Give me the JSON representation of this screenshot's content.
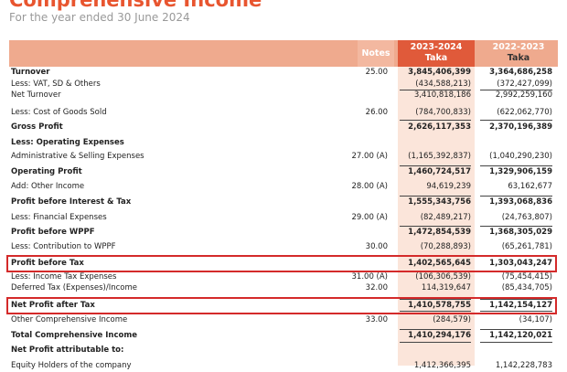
{
  "title": "Comprehensive Income",
  "subtitle": "For the year ended 30 June 2024",
  "header": {
    "notes": "Notes",
    "col1_year": "2023-2024",
    "col1_unit": "Taka",
    "col2_year": "2022-2023",
    "col2_unit": "Taka"
  },
  "rows": [
    {
      "label": "Turnover",
      "note": "25.00",
      "v1": "3,845,406,399",
      "v2": "3,364,686,258",
      "bold": true
    },
    {
      "label": "Less: VAT, SD & Others",
      "note": "",
      "v1": "(434,588,213)",
      "v2": "(372,427,099)",
      "bold": false
    },
    {
      "label": "Net Turnover",
      "note": "",
      "v1": "3,410,818,186",
      "v2": "2,992,259,160",
      "bold": false
    },
    {
      "label": "Less: Cost of Goods Sold",
      "note": "26.00",
      "v1": "(784,700,833)",
      "v2": "(622,062,770)",
      "bold": false
    },
    {
      "label": "Gross Profit",
      "note": "",
      "v1": "2,626,117,353",
      "v2": "2,370,196,389",
      "bold": true
    },
    {
      "label": "Less: Operating Expenses",
      "note": "",
      "v1": "",
      "v2": "",
      "bold": true
    },
    {
      "label": "Administrative & Selling Expenses",
      "note": "27.00 (A)",
      "v1": "(1,165,392,837)",
      "v2": "(1,040,290,230)",
      "bold": false
    },
    {
      "label": "Operating Profit",
      "note": "",
      "v1": "1,460,724,517",
      "v2": "1,329,906,159",
      "bold": true
    },
    {
      "label": "Add: Other Income",
      "note": "28.00 (A)",
      "v1": "94,619,239",
      "v2": "63,162,677",
      "bold": false
    },
    {
      "label": "Profit before Interest & Tax",
      "note": "",
      "v1": "1,555,343,756",
      "v2": "1,393,068,836",
      "bold": true
    },
    {
      "label": "Less: Financial Expenses",
      "note": "29.00 (A)",
      "v1": "(82,489,217)",
      "v2": "(24,763,807)",
      "bold": false
    },
    {
      "label": "Profit before WPPF",
      "note": "",
      "v1": "1,472,854,539",
      "v2": "1,368,305,029",
      "bold": true
    },
    {
      "label": "Less: Contribution to WPPF",
      "note": "30.00",
      "v1": "(70,288,893)",
      "v2": "(65,261,781)",
      "bold": false
    },
    {
      "label": "Profit before Tax",
      "note": "",
      "v1": "1,402,565,645",
      "v2": "1,303,043,247",
      "bold": true
    },
    {
      "label": "Less: Income Tax Expenses",
      "note": "31.00 (A)",
      "v1": "(106,306,539)",
      "v2": "(75,454,415)",
      "bold": false
    },
    {
      "label": "Deferred Tax (Expenses)/Income",
      "note": "32.00",
      "v1": "114,319,647",
      "v2": "(85,434,705)",
      "bold": false
    },
    {
      "label": "Net Profit after Tax",
      "note": "",
      "v1": "1,410,578,755",
      "v2": "1,142,154,127",
      "bold": true
    },
    {
      "label": "Other Comprehensive Income",
      "note": "33.00",
      "v1": "(284,579)",
      "v2": "(34,107)",
      "bold": false
    },
    {
      "label": "Total Comprehensive Income",
      "note": "",
      "v1": "1,410,294,176",
      "v2": "1,142,120,021",
      "bold": true
    },
    {
      "label": "Net Profit attributable to:",
      "note": "",
      "v1": "",
      "v2": "",
      "bold": true
    },
    {
      "label": "Equity Holders of the company",
      "note": "",
      "v1": "1,412,366,395",
      "v2": "1,142,228,783",
      "bold": false
    }
  ]
}
